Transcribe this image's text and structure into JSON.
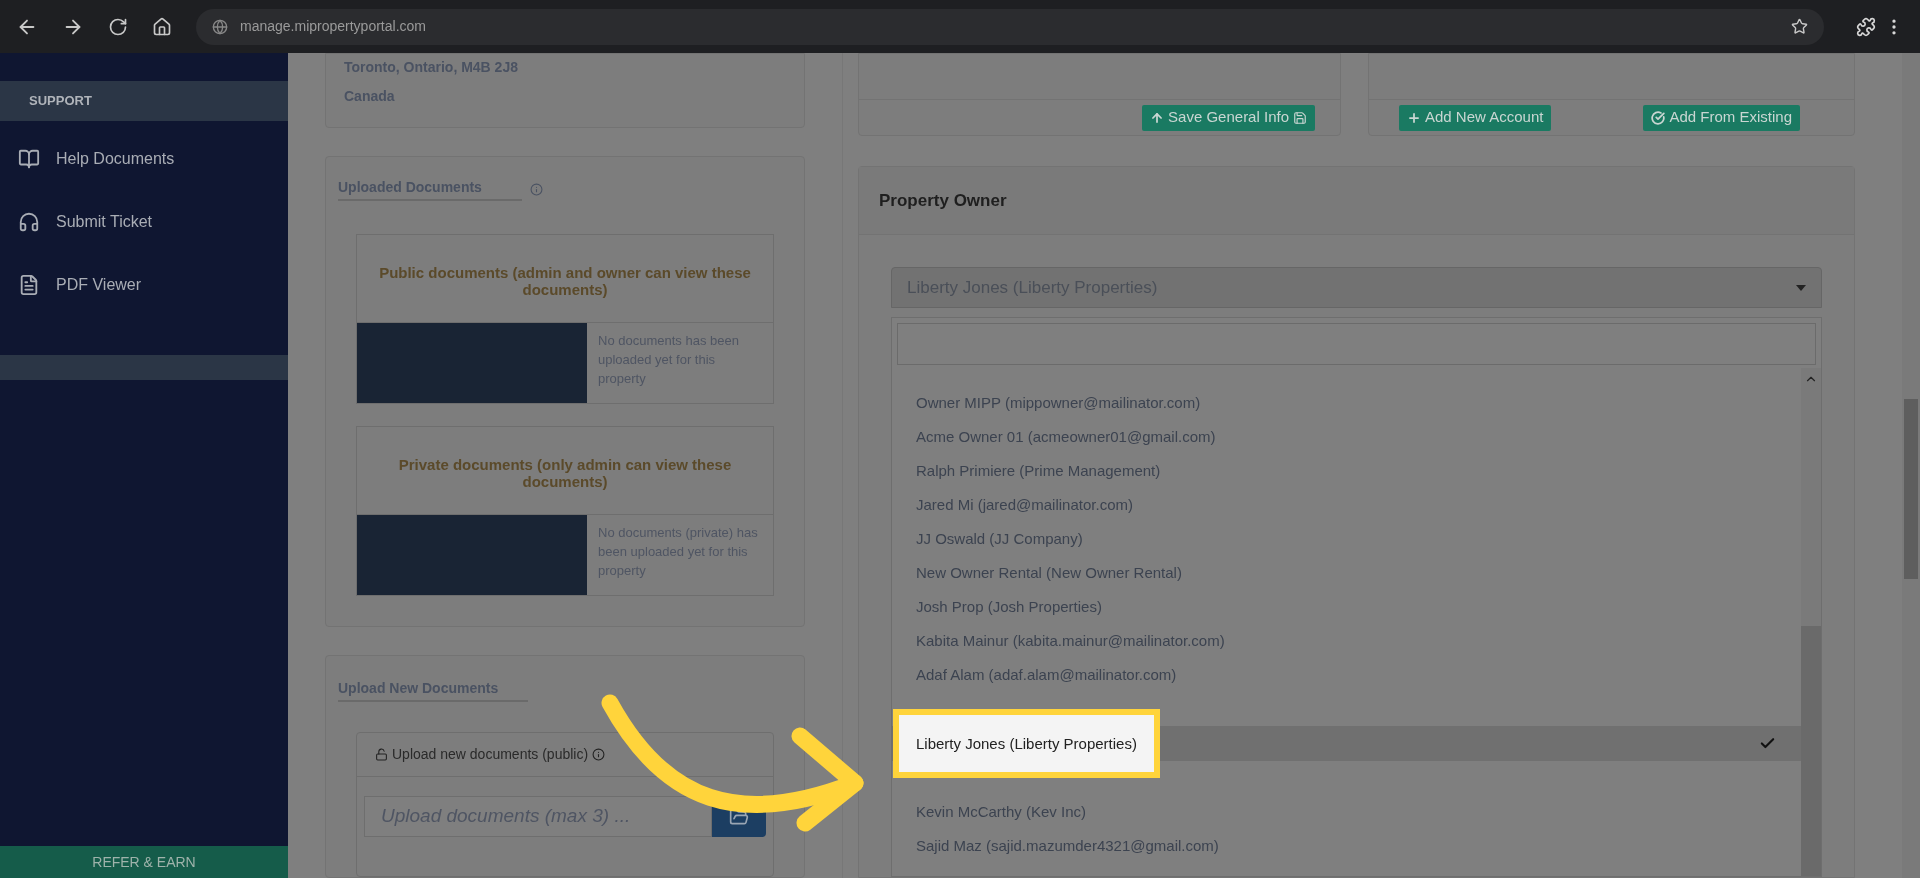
{
  "browser": {
    "url": "manage.mipropertyportal.com"
  },
  "sidebar": {
    "section": "SUPPORT",
    "items": [
      {
        "label": "Help Documents"
      },
      {
        "label": "Submit Ticket"
      },
      {
        "label": "PDF Viewer"
      }
    ],
    "footer": "REFER & EARN"
  },
  "address": {
    "lines": [
      "Toronto, Ontario, M4B 2J8",
      "Canada"
    ]
  },
  "uploaded_documents": {
    "title": "Uploaded Documents",
    "panels": [
      {
        "title": "Public documents (admin and owner can view these documents)",
        "message": "No documents has been uploaded yet for this property"
      },
      {
        "title": "Private documents (only admin can view these documents)",
        "message": "No documents (private) has been uploaded yet for this property"
      }
    ]
  },
  "upload_new": {
    "title": "Upload New Documents",
    "panel_title": "Upload new documents (public)",
    "placeholder": "Upload documents (max 3) ..."
  },
  "general_info": {
    "button": "Save General Info"
  },
  "accounts": {
    "buttons": [
      "Add New Account",
      "Add From Existing"
    ]
  },
  "property_owner": {
    "title": "Property Owner",
    "value": "Liberty Jones (Liberty Properties)",
    "options": [
      {
        "label": "Owner MIPP (mippowner@mailinator.com)",
        "selected": false
      },
      {
        "label": "Acme Owner 01 (acmeowner01@gmail.com)",
        "selected": false
      },
      {
        "label": "Ralph Primiere (Prime Management)",
        "selected": false
      },
      {
        "label": "Jared Mi (jared@mailinator.com)",
        "selected": false
      },
      {
        "label": "JJ Oswald (JJ Company)",
        "selected": false
      },
      {
        "label": "New Owner Rental (New Owner Rental)",
        "selected": false
      },
      {
        "label": "Josh Prop (Josh Properties)",
        "selected": false
      },
      {
        "label": "Kabita Mainur (kabita.mainur@mailinator.com)",
        "selected": false
      },
      {
        "label": "Adaf Alam (adaf.alam@mailinator.com)",
        "selected": false
      },
      {
        "label": "Liberty Jones (Liberty Properties)",
        "selected": true
      },
      {
        "label": "Kevin McCarthy (Kev Inc)",
        "selected": false
      },
      {
        "label": "Sajid Maz (sajid.mazumder4321@gmail.com)",
        "selected": false
      }
    ]
  }
}
